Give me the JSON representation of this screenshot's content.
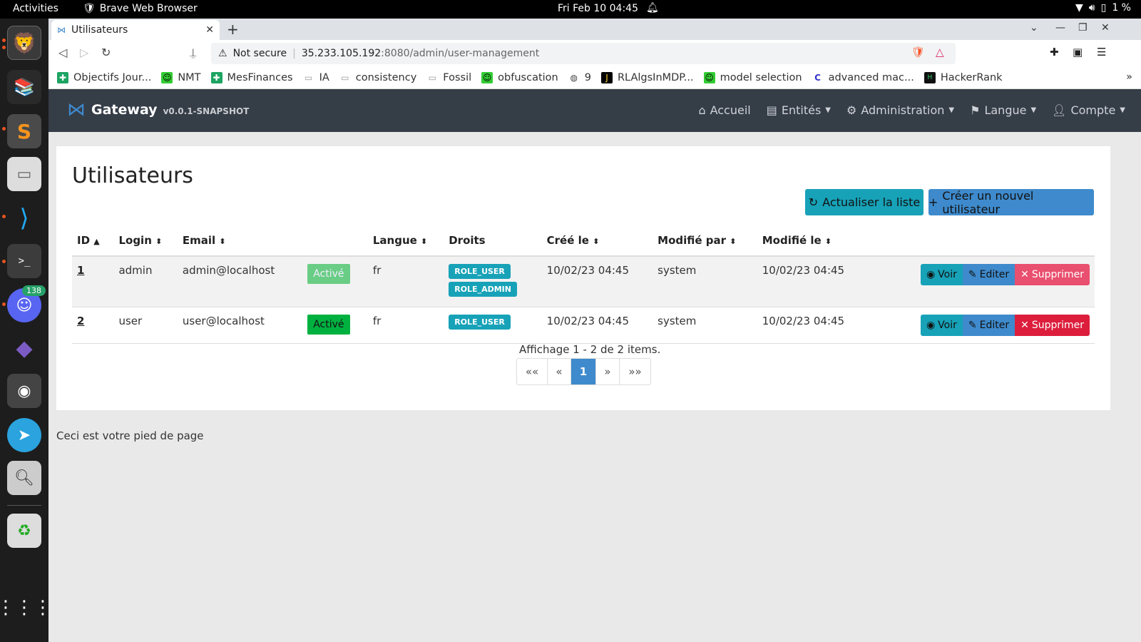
{
  "topbar": {
    "activities": "Activities",
    "app_name": "Brave Web Browser",
    "clock": "Fri Feb 10  04:45",
    "battery": "1 %"
  },
  "dock": {
    "discord_badge": "138"
  },
  "browser": {
    "tab_title": "Utilisateurs",
    "security_label": "Not secure",
    "url_host": "35.233.105.192",
    "url_path": ":8080/admin/user-management",
    "bookmarks": [
      {
        "label": "Objectifs Jour...",
        "icon": "plus-green-icon"
      },
      {
        "label": "NMT",
        "icon": "smiley-icon"
      },
      {
        "label": "MesFinances",
        "icon": "plus-green-icon"
      },
      {
        "label": "IA",
        "icon": "folder-icon"
      },
      {
        "label": "consistency",
        "icon": "folder-icon"
      },
      {
        "label": "Fossil",
        "icon": "folder-icon"
      },
      {
        "label": "obfuscation",
        "icon": "smiley-icon"
      },
      {
        "label": "9",
        "icon": "globe-icon"
      },
      {
        "label": "RLAlgsInMDP...",
        "icon": "jetbrains-icon"
      },
      {
        "label": "model selection",
        "icon": "smiley-icon"
      },
      {
        "label": "advanced mac...",
        "icon": "c-icon"
      },
      {
        "label": "HackerRank",
        "icon": "hackerrank-icon"
      }
    ],
    "bookmarks_more": "»"
  },
  "app": {
    "brand": "Gateway",
    "version": "v0.0.1-SNAPSHOT",
    "nav": {
      "home": "Accueil",
      "entities": "Entités",
      "admin": "Administration",
      "language": "Langue",
      "account": "Compte"
    }
  },
  "users_page": {
    "title": "Utilisateurs",
    "refresh_button": "Actualiser la liste",
    "create_button": "Créer un nouvel utilisateur",
    "columns": {
      "id": "ID",
      "login": "Login",
      "email": "Email",
      "lang": "Langue",
      "rights": "Droits",
      "created": "Créé le",
      "modified_by": "Modifié par",
      "modified": "Modifié le"
    },
    "rows": [
      {
        "id": "1",
        "login": "admin",
        "email": "admin@localhost",
        "status": "Activé",
        "lang": "fr",
        "roles": [
          "ROLE_USER",
          "ROLE_ADMIN"
        ],
        "created": "10/02/23 04:45",
        "modified_by": "system",
        "modified": "10/02/23 04:45"
      },
      {
        "id": "2",
        "login": "user",
        "email": "user@localhost",
        "status": "Activé",
        "lang": "fr",
        "roles": [
          "ROLE_USER"
        ],
        "created": "10/02/23 04:45",
        "modified_by": "system",
        "modified": "10/02/23 04:45"
      }
    ],
    "actions": {
      "view": "Voir",
      "edit": "Editer",
      "delete": "Supprimer"
    },
    "summary": "Affichage 1 - 2 de 2 items.",
    "pagination": {
      "first": "««",
      "prev": "«",
      "current": "1",
      "next": "»",
      "last": "»»"
    },
    "footer": "Ceci est votre pied de page"
  },
  "colors": {
    "navbar": "#353d47",
    "info": "#17a2b8",
    "primary": "#3e8acc",
    "danger": "#dc1e3c",
    "success": "#00b140"
  }
}
